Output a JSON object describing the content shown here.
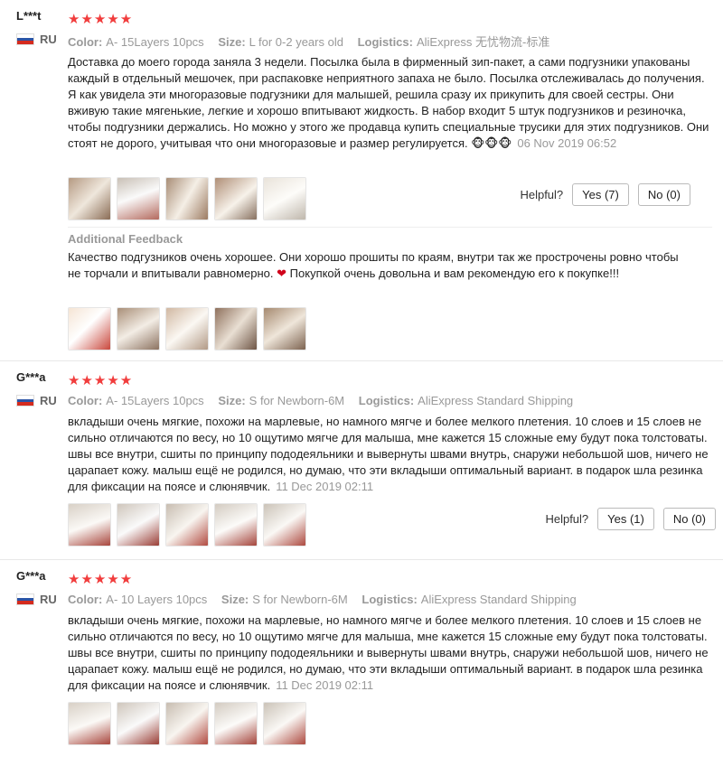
{
  "reviews": [
    {
      "user": "L***t",
      "stars": "★★★★★",
      "country": "RU",
      "color_label": "Color:",
      "color": "A- 15Layers 10pcs",
      "size_label": "Size:",
      "size": "L for 0-2 years old",
      "logistics_label": "Logistics:",
      "logistics": "AliExpress 无忧物流-标准",
      "text": "Доставка до моего города заняла 3 недели. Посылка была в фирменный зип-пакет, а сами подгузники упакованы каждый в отдельный мешочек, при распаковке неприятного запаха не было. Посылка отслеживалась до получения. Я как увидела эти многоразовые подгузники для малышей, решила сразу их прикупить для своей сестры. Они вживую такие мягенькие, легкие и хорошо впитывают жидкость. В набор входит 5 штук подгузников и резиночка, чтобы подгузники держались. Но можно у этого же продавца купить специальные трусики для этих подгузников. Они стоят не дорого, учитывая что они многоразовые и размер регулируется. 🐵🐵🐵",
      "date": "06 Nov 2019 06:52",
      "helpful_label": "Helpful?",
      "yes_label": "Yes (7)",
      "no_label": "No (0)",
      "additional_label": "Additional Feedback",
      "additional_text": "Качество подгузников очень хорошее. Они хорошо прошиты по краям, внутри так же прострочены ровно чтобы не торчали и впитывали равномерно.",
      "additional_text2": "Покупкой очень довольна и вам рекомендую его к покупке!!!"
    },
    {
      "user": "G***a",
      "stars": "★★★★★",
      "country": "RU",
      "color_label": "Color:",
      "color": "A- 15Layers 10pcs",
      "size_label": "Size:",
      "size": "S for Newborn-6M",
      "logistics_label": "Logistics:",
      "logistics": "AliExpress Standard Shipping",
      "text": "вкладыши очень мягкие, похожи на марлевые, но намного мягче и более мелкого плетения. 10 слоев и 15 слоев не сильно отличаются по весу, но 10 ощутимо мягче для малыша, мне кажется 15 сложные ему будут пока толстоваты. швы все внутри, сшиты по принципу пододеяльники и вывернуты швами внутрь, снаружи небольшой шов, ничего не царапает кожу. малыш ещё не родился, но думаю, что эти вкладыши оптимальный вариант. в подарок шла резинка для фиксации на поясе и слюнявчик.",
      "date": "11 Dec 2019 02:11",
      "helpful_label": "Helpful?",
      "yes_label": "Yes (1)",
      "no_label": "No (0)"
    },
    {
      "user": "G***a",
      "stars": "★★★★★",
      "country": "RU",
      "color_label": "Color:",
      "color": "A- 10 Layers 10pcs",
      "size_label": "Size:",
      "size": "S for Newborn-6M",
      "logistics_label": "Logistics:",
      "logistics": "AliExpress Standard Shipping",
      "text": "вкладыши очень мягкие, похожи на марлевые, но намного мягче и более мелкого плетения. 10 слоев и 15 слоев не сильно отличаются по весу, но 10 ощутимо мягче для малыша, мне кажется 15 сложные ему будут пока толстоваты. швы все внутри, сшиты по принципу пододеяльники и вывернуты швами внутрь, снаружи небольшой шов, ничего не царапает кожу. малыш ещё не родился, но думаю, что эти вкладыши оптимальный вариант. в подарок шла резинка для фиксации на поясе и слюнявчик.",
      "date": "11 Dec 2019 02:11"
    }
  ]
}
